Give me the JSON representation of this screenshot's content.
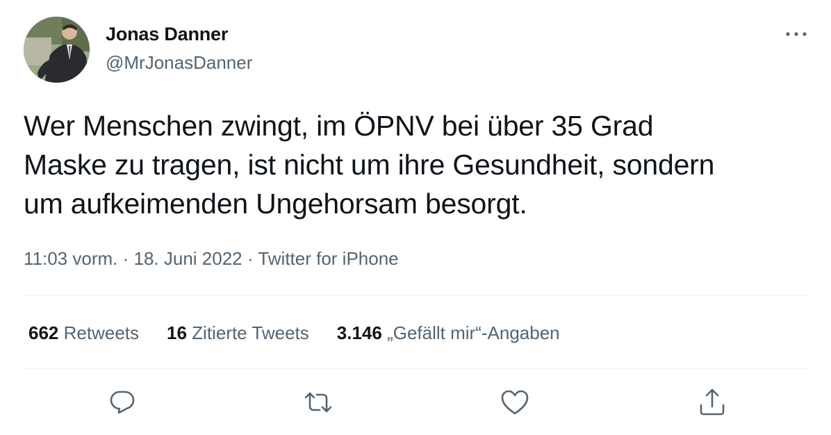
{
  "user": {
    "name": "Jonas Danner",
    "handle": "@MrJonasDanner"
  },
  "tweet": {
    "lines": [
      "Wer Menschen zwingt, im ÖPNV bei über 35 Grad",
      "Maske zu tragen, ist nicht um ihre Gesundheit, sondern",
      "um aufkeimenden Ungehorsam besorgt."
    ],
    "time": "11:03 vorm.",
    "date": "18. Juni 2022",
    "source": "Twitter for iPhone",
    "separator": "·"
  },
  "stats": {
    "retweets_count": "662",
    "retweets_label": "Retweets",
    "quotes_count": "16",
    "quotes_label": "Zitierte Tweets",
    "likes_count": "3.146",
    "likes_label": "„Gefällt mir“-Angaben"
  },
  "icons": {
    "more": "more-horizontal-icon",
    "reply": "reply-icon",
    "retweet": "retweet-icon",
    "like": "heart-icon",
    "share": "share-icon"
  },
  "colors": {
    "text": "#0f1419",
    "secondary": "#536471",
    "divider": "#eff3f4"
  }
}
